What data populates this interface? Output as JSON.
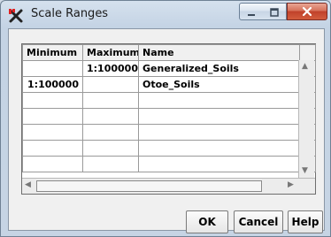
{
  "window": {
    "title": "Scale Ranges"
  },
  "table": {
    "columns": [
      "Minimum",
      "Maximum",
      "Name"
    ],
    "rows": [
      {
        "minimum": "",
        "maximum": "1:100000",
        "name": "Generalized_Soils"
      },
      {
        "minimum": "1:100000",
        "maximum": "",
        "name": "Otoe_Soils"
      }
    ]
  },
  "buttons": {
    "ok": "OK",
    "cancel": "Cancel",
    "help": "Help"
  },
  "icons": {
    "app": "scale-ranges-app-icon",
    "minimize": "minimize-icon",
    "maximize": "maximize-icon",
    "close": "close-icon"
  }
}
